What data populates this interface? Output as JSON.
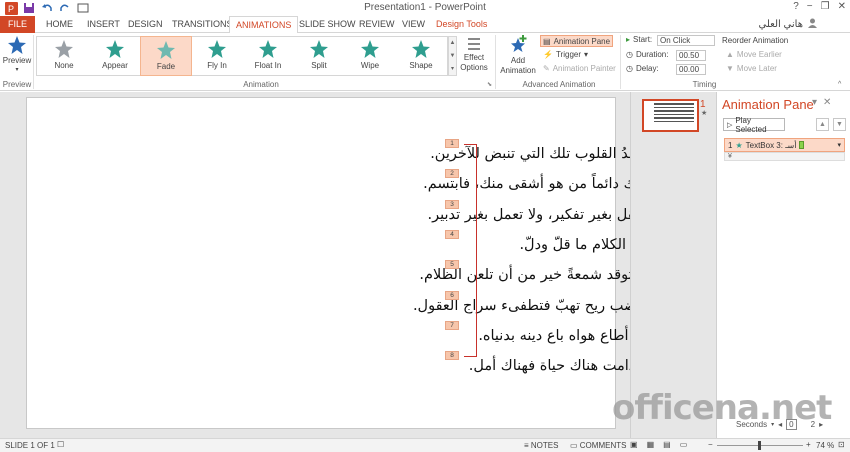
{
  "window": {
    "title": "Presentation1 - PowerPoint",
    "help": "?",
    "minimize": "−",
    "restore": "❐",
    "close": "✕"
  },
  "user": {
    "name": "هاني العلي"
  },
  "tabs": [
    {
      "label": "FILE"
    },
    {
      "label": "HOME"
    },
    {
      "label": "INSERT"
    },
    {
      "label": "DESIGN"
    },
    {
      "label": "TRANSITIONS"
    },
    {
      "label": "ANIMATIONS"
    },
    {
      "label": "SLIDE SHOW"
    },
    {
      "label": "REVIEW"
    },
    {
      "label": "VIEW"
    },
    {
      "label": "Design Tools"
    }
  ],
  "ribbon": {
    "preview": {
      "label": "Preview",
      "group": "Preview"
    },
    "animations": [
      {
        "label": "None",
        "color": "#9aa0a6"
      },
      {
        "label": "Appear",
        "color": "#2f9e8f"
      },
      {
        "label": "Fade",
        "color": "#6fb9b0"
      },
      {
        "label": "Fly In",
        "color": "#2f9e8f"
      },
      {
        "label": "Float In",
        "color": "#2f9e8f"
      },
      {
        "label": "Split",
        "color": "#2f9e8f"
      },
      {
        "label": "Wipe",
        "color": "#2f9e8f"
      },
      {
        "label": "Shape",
        "color": "#2f9e8f"
      }
    ],
    "effect_options": {
      "label1": "Effect",
      "label2": "Options"
    },
    "animation_group": "Animation",
    "add_animation": {
      "label1": "Add",
      "label2": "Animation"
    },
    "animation_pane": "Animation Pane",
    "trigger": "Trigger",
    "animation_painter": "Animation Painter",
    "advanced_group": "Advanced Animation",
    "start": {
      "label": "Start:",
      "value": "On Click"
    },
    "duration": {
      "label": "Duration:",
      "value": "00.50"
    },
    "delay": {
      "label": "Delay:",
      "value": "00.00"
    },
    "reorder": {
      "title": "Reorder Animation",
      "earlier": "Move Earlier",
      "later": "Move Later"
    },
    "timing_group": "Timing"
  },
  "slide": {
    "lines": [
      {
        "num": "1",
        "text": "❖أسعدُ القلوب تلك التي تنبض للآخرين."
      },
      {
        "num": "2",
        "text": "❖هناك دائماً من هو أشقى منك، فابتسم."
      },
      {
        "num": "3",
        "text": "❖لا تقل بغير تفكير، ولا تعمل بغير تدبير."
      },
      {
        "num": "4",
        "text": "❖خير الكلام ما قلّ ودلّ."
      },
      {
        "num": "5",
        "text": "❖أن توقد شمعةً خير من أن تلعن الظلام."
      },
      {
        "num": "6",
        "text": "❖الغضب ريح تهبّ فتطفىء سراج العقول."
      },
      {
        "num": "7",
        "text": "❖من أطاع هواه باع دينه بدنياه."
      },
      {
        "num": "8",
        "text": "❖ما دامت هناك حياة فهناك أمل."
      }
    ]
  },
  "thumbnail": {
    "number": "1",
    "star": "★"
  },
  "animation_pane": {
    "title": "Animation Pane",
    "play_selected": "Play Selected",
    "item": {
      "number": "1",
      "label": "TextBox 3: أسـ"
    },
    "seconds": "Seconds",
    "page_a": "0",
    "page_b": "2"
  },
  "watermark": "officena.net",
  "status": {
    "slide": "SLIDE 1 OF 1",
    "notes": "NOTES",
    "comments": "COMMENTS",
    "zoom": "74 %"
  }
}
